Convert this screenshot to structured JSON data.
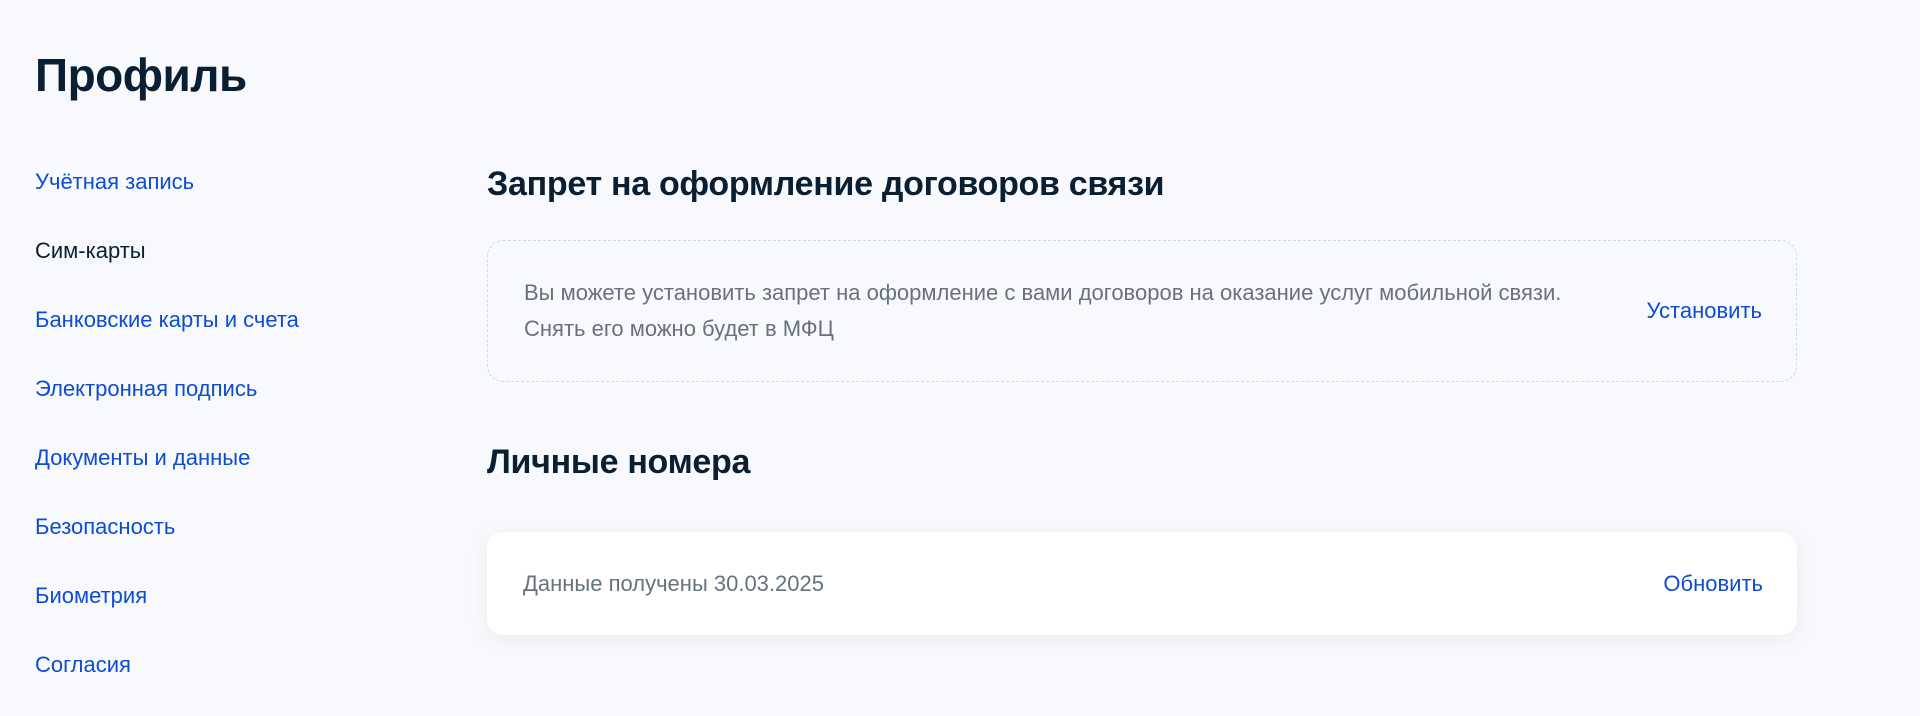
{
  "page": {
    "title": "Профиль"
  },
  "sidebar": {
    "items": [
      {
        "label": "Учётная запись",
        "active": false
      },
      {
        "label": "Сим-карты",
        "active": true
      },
      {
        "label": "Банковские карты и счета",
        "active": false
      },
      {
        "label": "Электронная подпись",
        "active": false
      },
      {
        "label": "Документы и данные",
        "active": false
      },
      {
        "label": "Безопасность",
        "active": false
      },
      {
        "label": "Биометрия",
        "active": false
      },
      {
        "label": "Согласия",
        "active": false
      }
    ]
  },
  "main": {
    "ban_section": {
      "title": "Запрет на оформление договоров связи",
      "text": "Вы можете установить запрет на оформление с вами договоров на оказание услуг мобильной связи. Снять его можно будет в МФЦ",
      "action_label": "Установить"
    },
    "numbers_section": {
      "title": "Личные номера",
      "status_text": "Данные получены 30.03.2025",
      "action_label": "Обновить"
    }
  },
  "colors": {
    "link": "#0d4cd3",
    "text": "#0b1f33",
    "muted": "#66727f",
    "background": "#f8f9fc"
  }
}
